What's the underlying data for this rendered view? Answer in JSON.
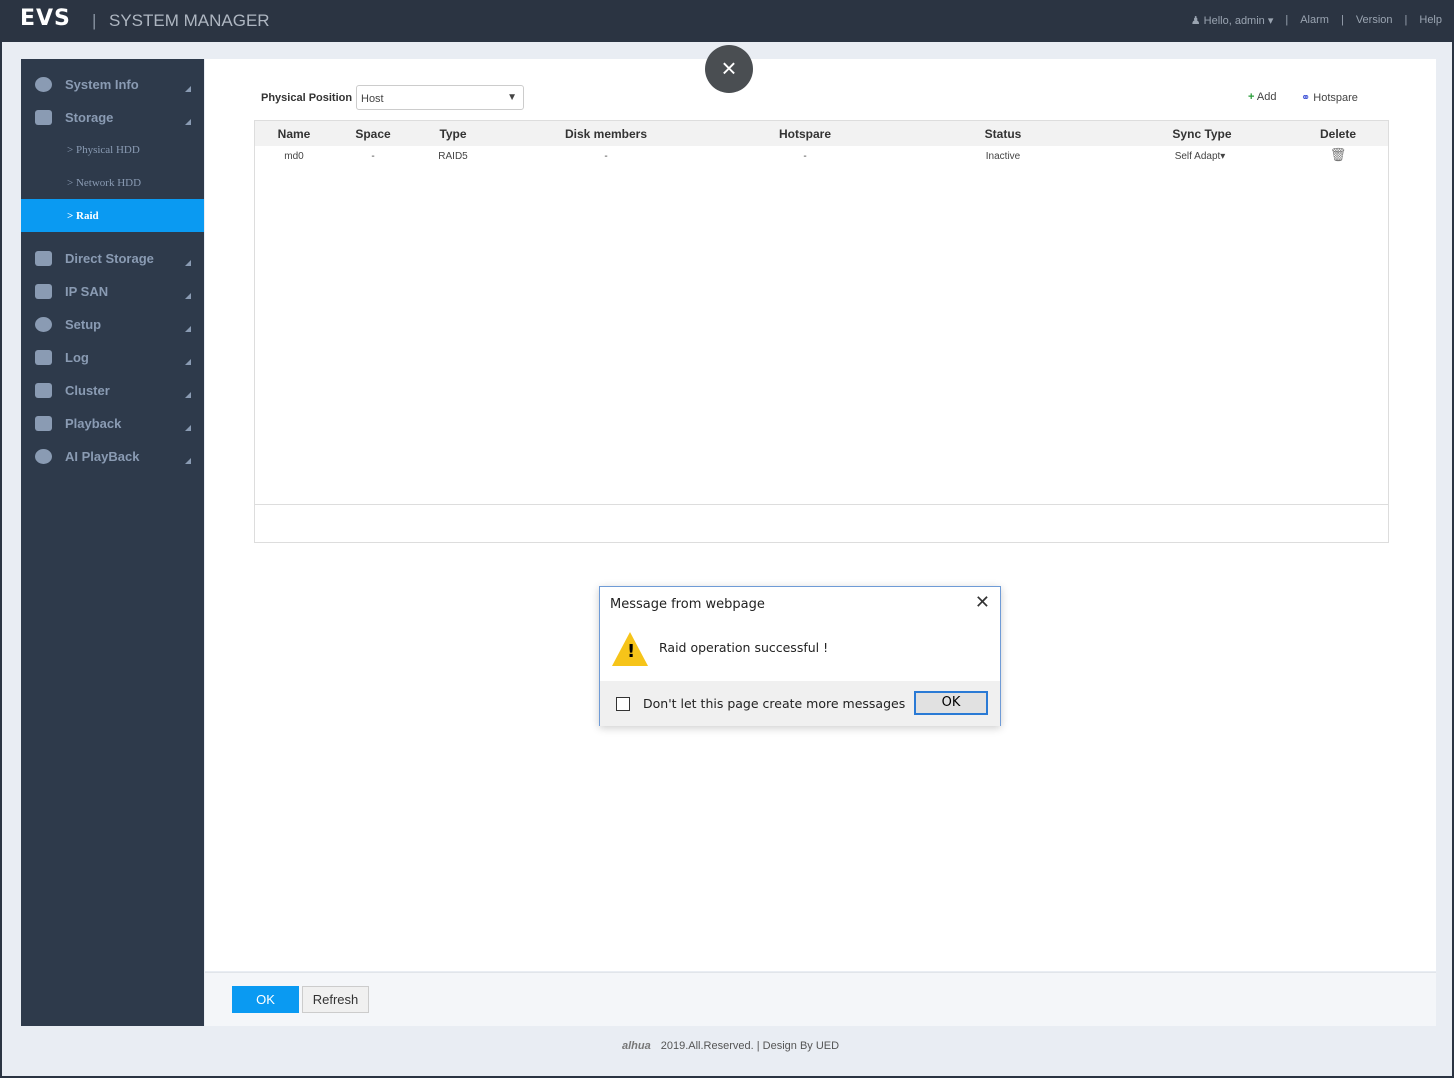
{
  "header": {
    "logo": "EVS",
    "title": "SYSTEM MANAGER",
    "user": "Hello, admin",
    "links": [
      "Alarm",
      "Version",
      "Help"
    ]
  },
  "sidebar": {
    "items": [
      {
        "label": "System Info",
        "icon": "pie-chart-icon"
      },
      {
        "label": "Storage",
        "icon": "floppy-icon"
      },
      {
        "label": "Direct Storage",
        "icon": "direct-storage-icon"
      },
      {
        "label": "IP SAN",
        "icon": "server-icon"
      },
      {
        "label": "Setup",
        "icon": "gear-icon"
      },
      {
        "label": "Log",
        "icon": "document-icon"
      },
      {
        "label": "Cluster",
        "icon": "hierarchy-icon"
      },
      {
        "label": "Playback",
        "icon": "playback-icon"
      },
      {
        "label": "AI PlayBack",
        "icon": "ai-head-icon"
      }
    ],
    "sub": [
      "> Physical HDD",
      "> Network HDD",
      "> Raid"
    ]
  },
  "filter": {
    "label": "Physical Position",
    "value": "Host"
  },
  "actions": {
    "add": "Add",
    "hotspare": "Hotspare"
  },
  "table": {
    "columns": [
      "Name",
      "Space",
      "Type",
      "Disk members",
      "Hotspare",
      "Status",
      "Sync Type",
      "Delete"
    ],
    "rows": [
      [
        "md0",
        "-",
        "RAID5",
        "-",
        "-",
        "Inactive",
        "Self Adapt"
      ]
    ]
  },
  "buttons": {
    "ok": "OK",
    "refresh": "Refresh"
  },
  "footer": {
    "brand": "alhua",
    "text": "2019.All.Reserved. | Design By UED"
  },
  "dialog": {
    "title": "Message from webpage",
    "message": "Raid operation successful !",
    "checkbox": "Don't let this page create more messages",
    "ok": "OK"
  }
}
